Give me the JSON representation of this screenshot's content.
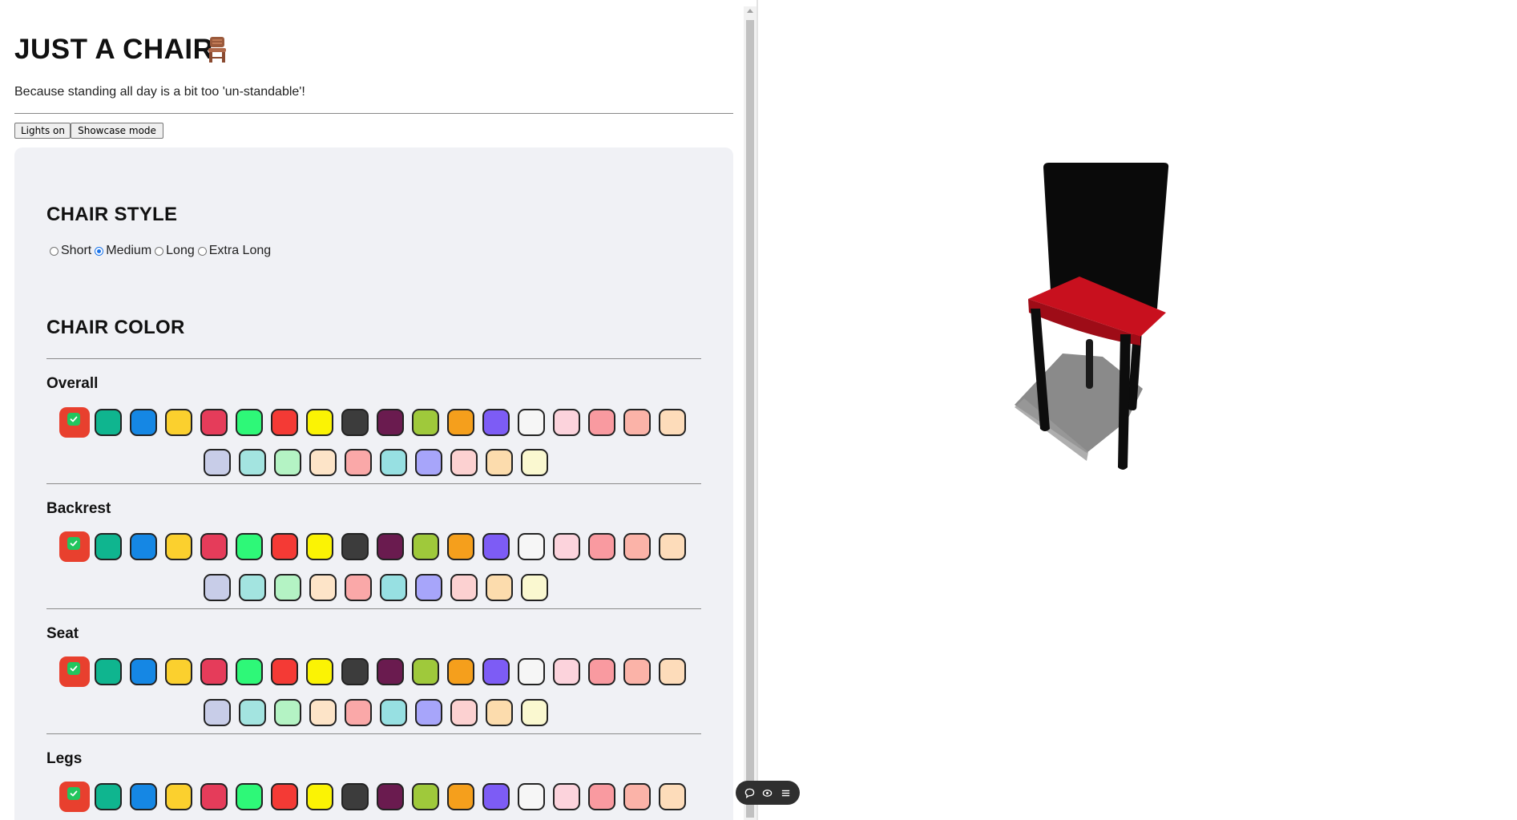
{
  "header": {
    "title": "JUST A CHAIR",
    "emoji_icon": "chair-emoji-icon",
    "tagline": "Because standing all day is a bit too 'un-standable'!"
  },
  "buttons": {
    "lights": "Lights on",
    "showcase": "Showcase mode"
  },
  "chair_style": {
    "title": "CHAIR STYLE",
    "options": [
      "Short",
      "Medium",
      "Long",
      "Extra Long"
    ],
    "selected": "Medium"
  },
  "chair_color": {
    "title": "CHAIR COLOR",
    "palette_row1": [
      "#e8402e",
      "#0fb58f",
      "#1587e4",
      "#fbd02e",
      "#e53c5a",
      "#2ef878",
      "#f43a35",
      "#fbf304",
      "#3c3c3c",
      "#6a1b4f",
      "#9fc93b",
      "#f59f1c",
      "#7d5cf5",
      "#f6f6f6",
      "#fcd3dc",
      "#f99aa0",
      "#fbb3a8",
      "#fddcba"
    ],
    "palette_row2": [
      "#c8cde8",
      "#a3e4e0",
      "#b4f3c4",
      "#fde4c8",
      "#faa8a8",
      "#97e0e2",
      "#a7a5fa",
      "#fcd1d1",
      "#fcdcad",
      "#faf8d0"
    ],
    "selected_color": "#e8402e",
    "groups": [
      {
        "label": "Overall"
      },
      {
        "label": "Backrest"
      },
      {
        "label": "Seat"
      },
      {
        "label": "Legs"
      }
    ]
  },
  "toolbar": {
    "icons": [
      "comment-icon",
      "view-icon",
      "menu-icon"
    ]
  },
  "viewer": {
    "backrest_color": "#0a0a0a",
    "seat_color": "#c8101e",
    "legs_color": "#0a0a0a"
  }
}
